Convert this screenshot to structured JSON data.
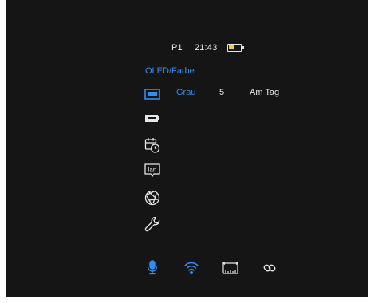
{
  "status": {
    "profile": "P1",
    "time": "21:43",
    "battery_level": 0.55,
    "battery_color": "#f4d400"
  },
  "section": {
    "title": "OLED/Farbe"
  },
  "display": {
    "color_mode": "Grau",
    "brightness": "5",
    "scene_mode": "Am Tag"
  },
  "menu_icons": [
    "display-icon",
    "battery-pack-icon",
    "calendar-clock-icon",
    "language-icon",
    "shutter-icon",
    "wrench-icon"
  ],
  "bottom_icons": [
    "microphone-icon",
    "wifi-icon",
    "ruler-icon",
    "link-icon"
  ],
  "colors": {
    "accent": "#2d8ff0",
    "background": "#151515",
    "text": "#e6e6e6"
  },
  "language_label": "lan"
}
